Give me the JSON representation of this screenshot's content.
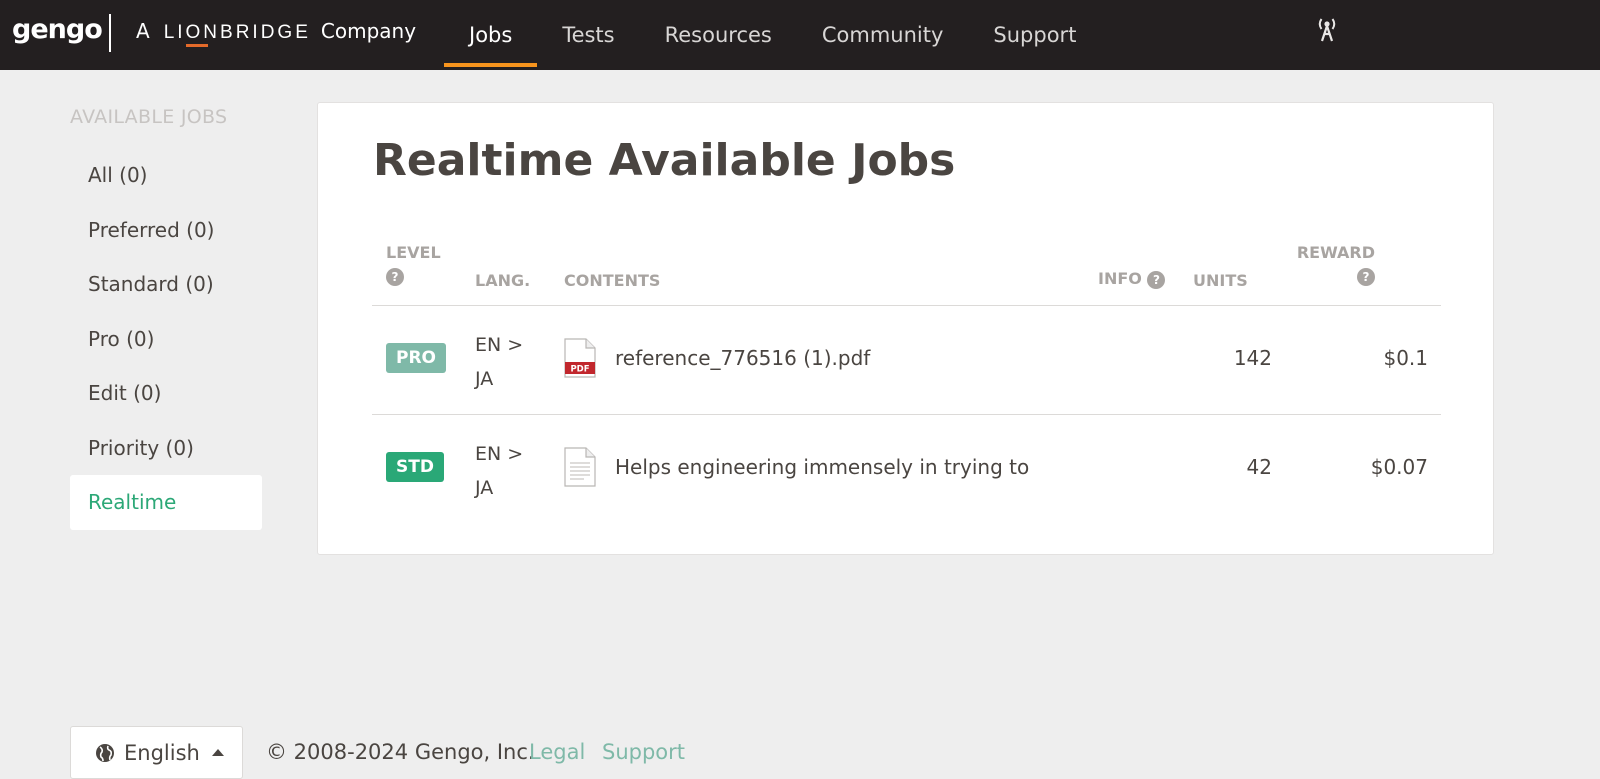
{
  "header": {
    "logo": "gengo",
    "partner_prefix": "A",
    "partner_name": "LIONBRIDGE",
    "partner_suffix": "Company",
    "nav": [
      {
        "label": "Jobs",
        "active": true
      },
      {
        "label": "Tests",
        "active": false
      },
      {
        "label": "Resources",
        "active": false
      },
      {
        "label": "Community",
        "active": false
      },
      {
        "label": "Support",
        "active": false
      }
    ],
    "status_icon": "antenna-icon"
  },
  "sidebar": {
    "heading": "AVAILABLE JOBS",
    "items": [
      {
        "label": "All (0)",
        "active": false
      },
      {
        "label": "Preferred (0)",
        "active": false
      },
      {
        "label": "Standard (0)",
        "active": false
      },
      {
        "label": "Pro (0)",
        "active": false
      },
      {
        "label": "Edit (0)",
        "active": false
      },
      {
        "label": "Priority (0)",
        "active": false
      },
      {
        "label": "Realtime",
        "active": true
      }
    ]
  },
  "main": {
    "title": "Realtime Available Jobs",
    "columns": {
      "level": "LEVEL",
      "lang": "LANG.",
      "contents": "CONTENTS",
      "info": "INFO",
      "units": "UNITS",
      "reward": "REWARD",
      "help_glyph": "?"
    },
    "rows": [
      {
        "level": "PRO",
        "lang_line1": "EN >",
        "lang_line2": "JA",
        "icon": "pdf-file-icon",
        "content": "reference_776516 (1).pdf",
        "units": "142",
        "reward": "$0.1"
      },
      {
        "level": "STD",
        "lang_line1": "EN >",
        "lang_line2": "JA",
        "icon": "text-file-icon",
        "content": "Helps engineering immensely in trying to",
        "units": "42",
        "reward": "$0.07"
      }
    ]
  },
  "footer": {
    "language": "English",
    "copyright": "© 2008-2024 Gengo, Inc.",
    "legal": "Legal",
    "support": "Support"
  },
  "colors": {
    "topbar": "#231f20",
    "nav_accent": "#f7941d",
    "green": "#2aa877",
    "pro_badge": "#7fb9a8",
    "link": "#7fb9a8"
  }
}
